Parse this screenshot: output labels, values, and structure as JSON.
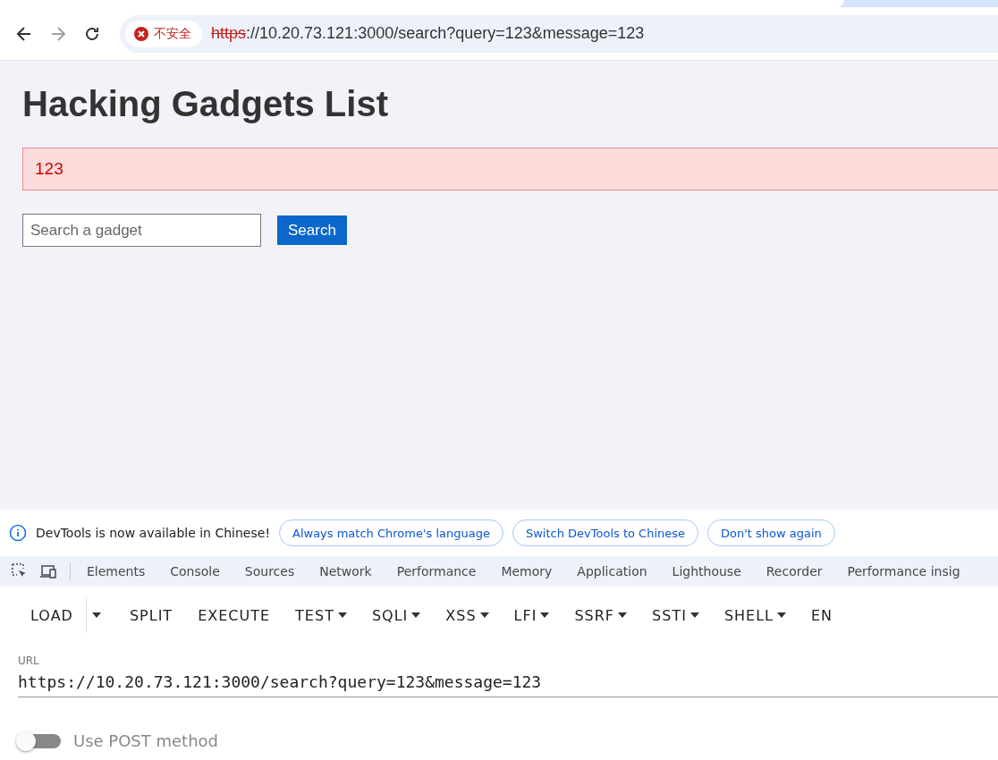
{
  "browser": {
    "security_label": "不安全",
    "address": {
      "scheme": "https",
      "rest": "://10.20.73.121:3000/search?query=123&message=123"
    },
    "forward_disabled": true
  },
  "page": {
    "title": "Hacking Gadgets List",
    "message": "123",
    "search": {
      "placeholder": "Search a gadget",
      "button": "Search"
    }
  },
  "devtools": {
    "infobar": {
      "text": "DevTools is now available in Chinese!",
      "buttons": [
        "Always match Chrome's language",
        "Switch DevTools to Chinese",
        "Don't show again"
      ]
    },
    "tabs": [
      {
        "label": "Elements",
        "selected": false
      },
      {
        "label": "Console",
        "selected": false
      },
      {
        "label": "Sources",
        "selected": false
      },
      {
        "label": "Network",
        "selected": false
      },
      {
        "label": "Performance",
        "selected": false
      },
      {
        "label": "Memory",
        "selected": false
      },
      {
        "label": "Application",
        "selected": false
      },
      {
        "label": "Lighthouse",
        "selected": false
      },
      {
        "label": "Recorder",
        "selected": false
      },
      {
        "label": "Performance insig",
        "selected": false
      }
    ],
    "toolbar": [
      {
        "label": "LOAD",
        "kind": "split"
      },
      {
        "label": "SPLIT",
        "kind": "plain"
      },
      {
        "label": "EXECUTE",
        "kind": "plain"
      },
      {
        "label": "TEST",
        "kind": "menu"
      },
      {
        "label": "SQLI",
        "kind": "menu"
      },
      {
        "label": "XSS",
        "kind": "menu"
      },
      {
        "label": "LFI",
        "kind": "menu"
      },
      {
        "label": "SSRF",
        "kind": "menu"
      },
      {
        "label": "SSTI",
        "kind": "menu"
      },
      {
        "label": "SHELL",
        "kind": "menu"
      },
      {
        "label": "EN",
        "kind": "plain"
      }
    ],
    "url_label": "URL",
    "url_value": "https://10.20.73.121:3000/search?query=123&message=123",
    "post_toggle": {
      "label": "Use POST method",
      "on": false
    }
  }
}
